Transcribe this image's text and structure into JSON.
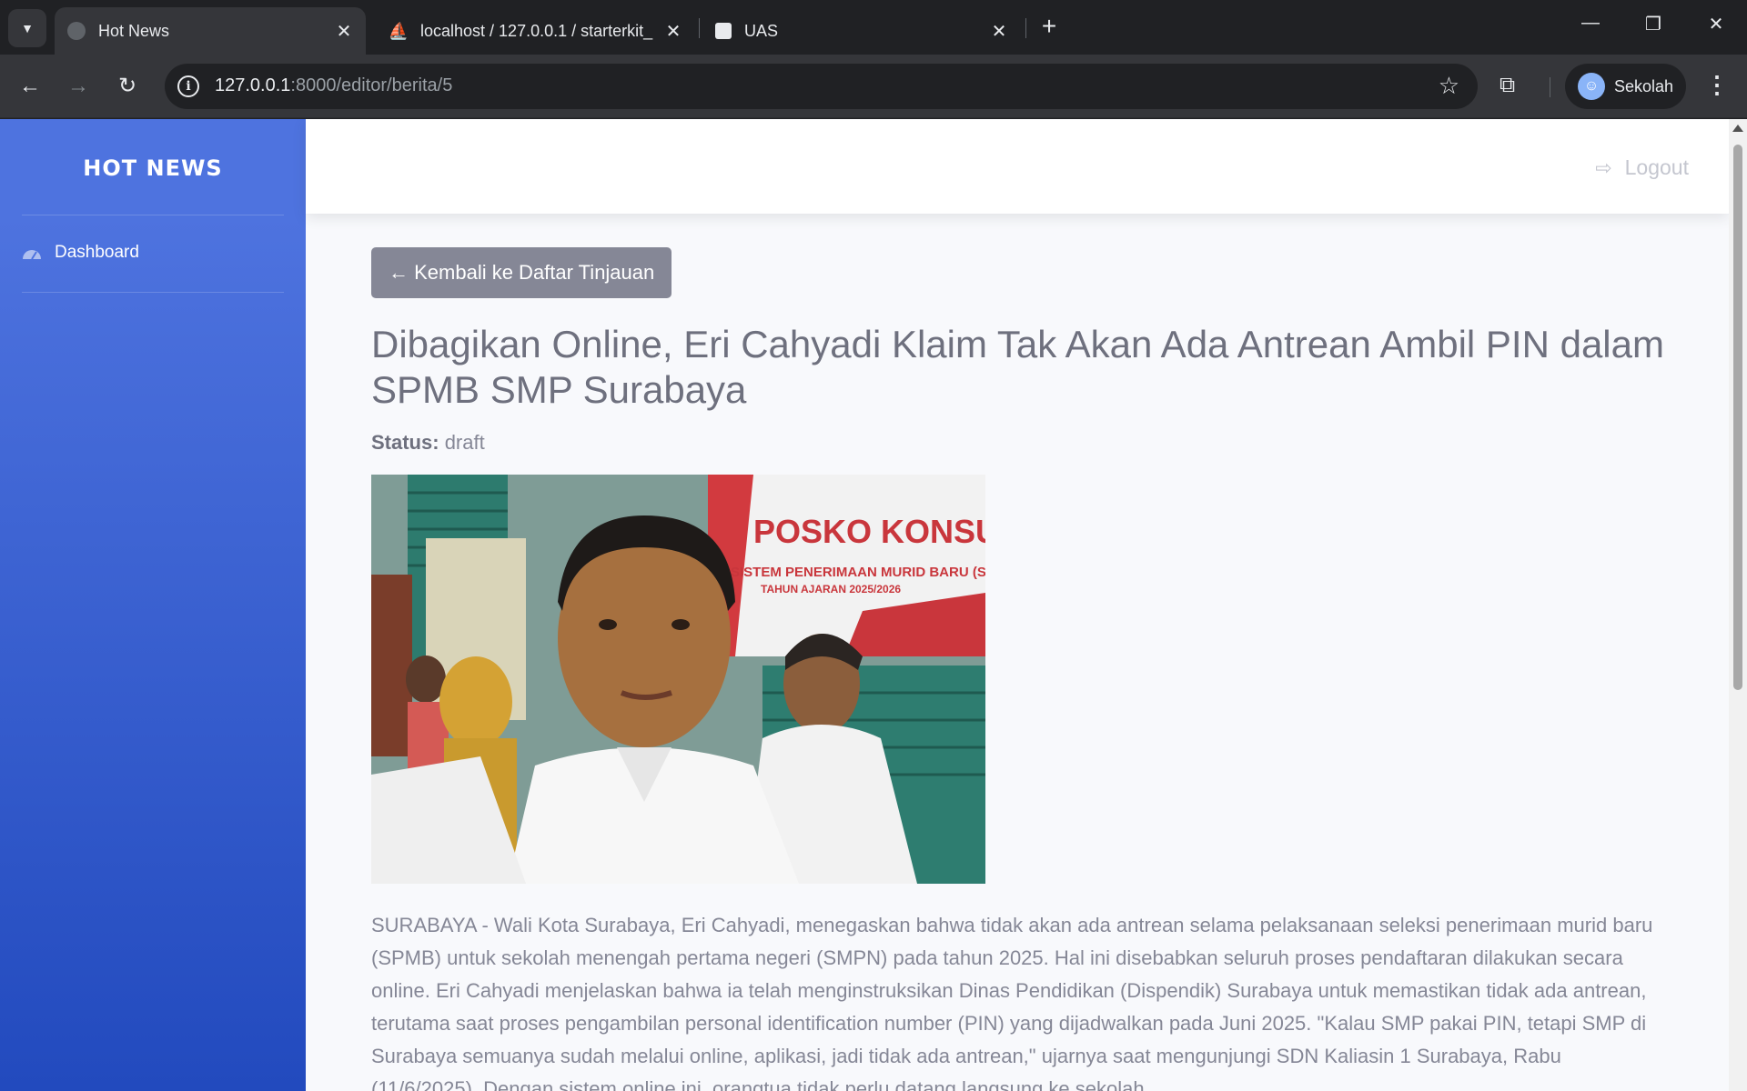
{
  "browser": {
    "tabs": [
      {
        "title": "Hot News",
        "active": true
      },
      {
        "title": "localhost / 127.0.0.1 / starterkit_",
        "active": false
      },
      {
        "title": "UAS",
        "active": false
      }
    ],
    "url_host": "127.0.0.1",
    "url_rest": ":8000/editor/berita/5",
    "profile_name": "Sekolah"
  },
  "sidebar": {
    "brand": "HOT NEWS",
    "items": [
      {
        "label": "Dashboard",
        "icon": "tachometer-icon"
      }
    ]
  },
  "topbar": {
    "logout_label": "Logout"
  },
  "article": {
    "back_label": "← Kembali ke Daftar Tinjauan",
    "title": "Dibagikan Online, Eri Cahyadi Klaim Tak Akan Ada Antrean Ambil PIN dalam SPMB SMP Surabaya",
    "status_label": "Status:",
    "status_value": "draft",
    "image_banner_title": "POSKO KONSULTASI",
    "image_banner_sub": "SISTEM PENERIMAAN MURID BARU (S",
    "image_banner_year": "TAHUN AJARAN 2025/2026",
    "body": "SURABAYA - Wali Kota Surabaya, Eri Cahyadi, menegaskan bahwa tidak akan ada antrean selama pelaksanaan seleksi penerimaan murid baru (SPMB) untuk sekolah menengah pertama negeri (SMPN) pada tahun 2025. Hal ini disebabkan seluruh proses pendaftaran dilakukan secara online. Eri Cahyadi menjelaskan bahwa ia telah menginstruksikan Dinas Pendidikan (Dispendik) Surabaya untuk memastikan tidak ada antrean, terutama saat proses pengambilan personal identification number (PIN) yang dijadwalkan pada Juni 2025. \"Kalau SMP pakai PIN, tetapi SMP di Surabaya semuanya sudah melalui online, aplikasi, jadi tidak ada antrean,\" ujarnya saat mengunjungi SDN Kaliasin 1 Surabaya, Rabu (11/6/2025). Dengan sistem online ini, orangtua tidak perlu datang langsung ke sekolah."
  },
  "colors": {
    "sidebar_start": "#4e73df",
    "sidebar_end": "#224abe",
    "back_button": "#858796",
    "page_bg": "#f8f9fc"
  }
}
